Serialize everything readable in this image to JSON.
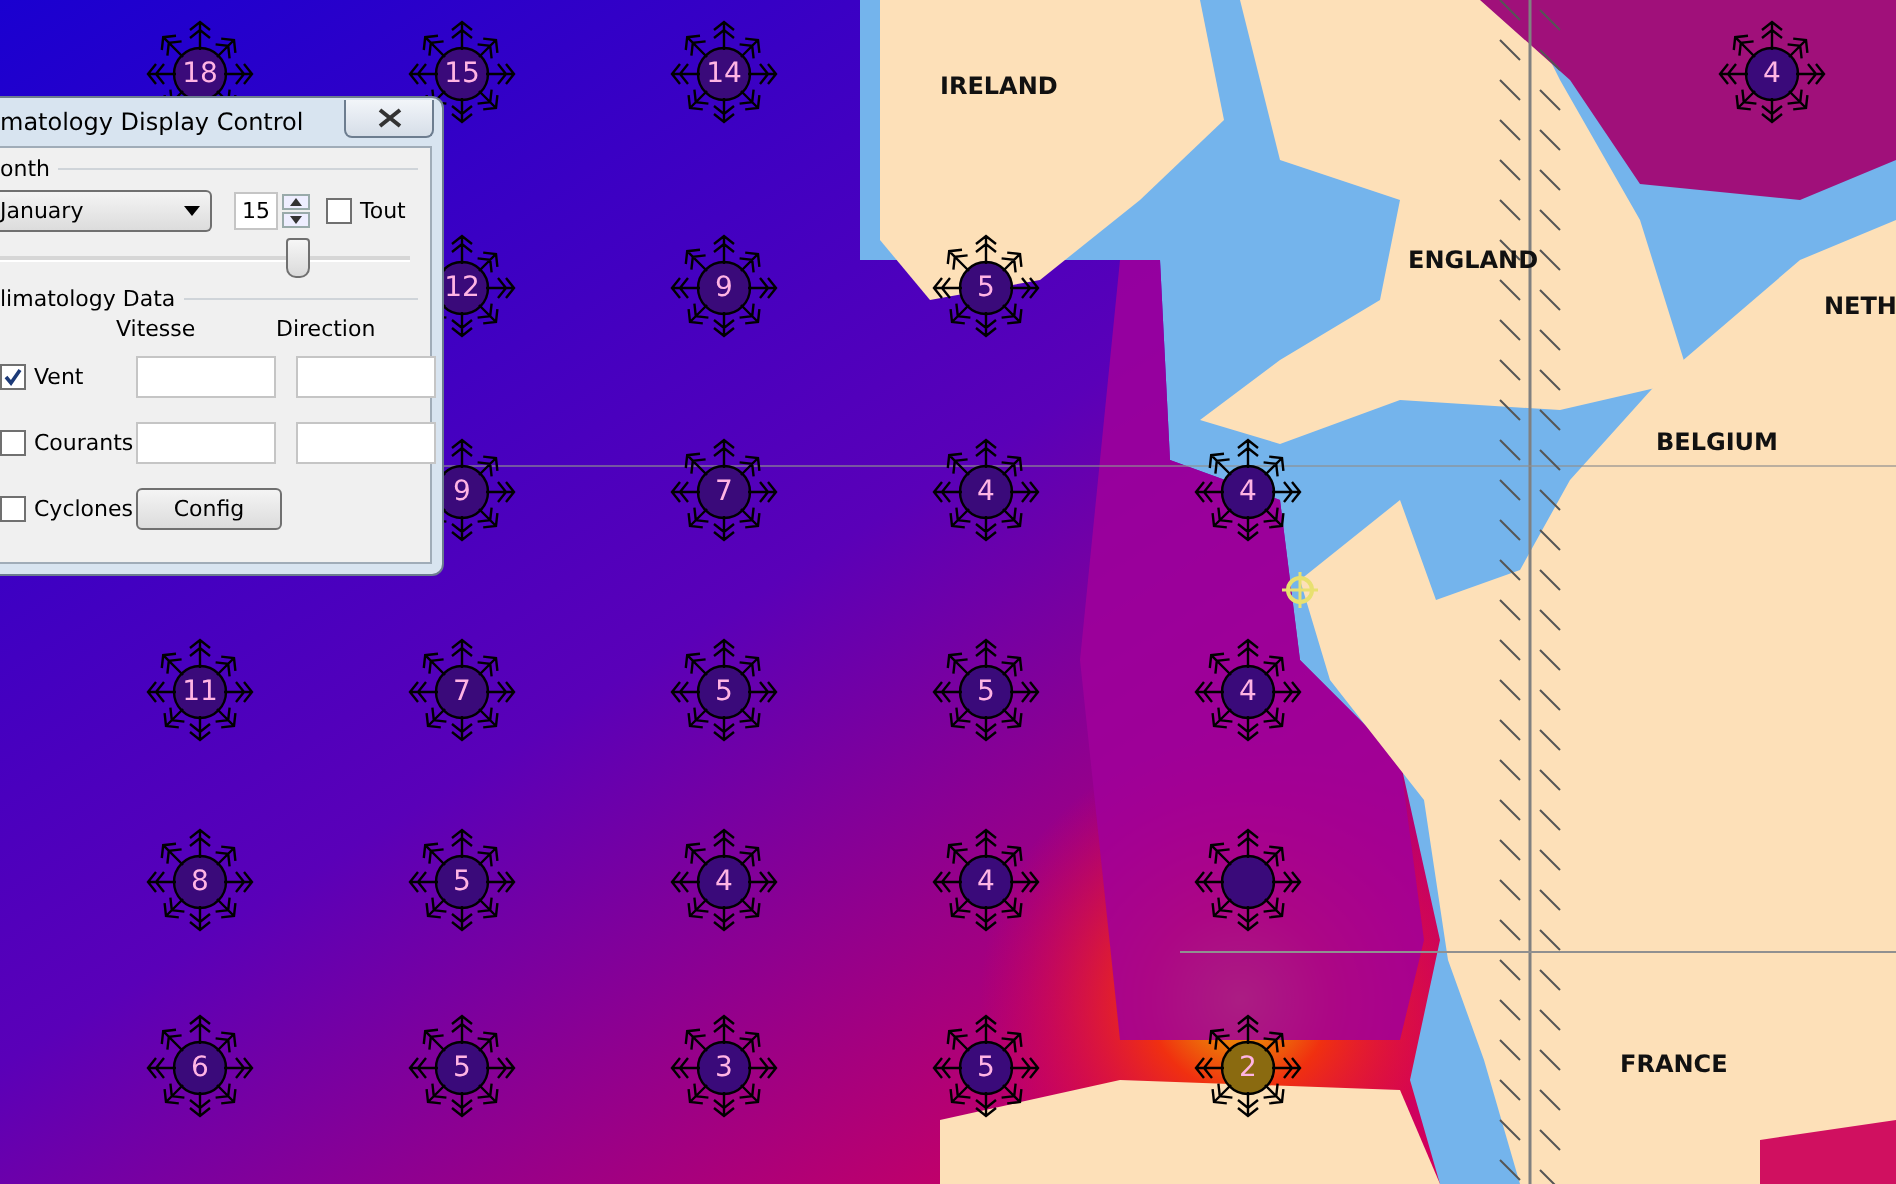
{
  "map": {
    "countries": [
      "IRELAND",
      "ENGLAND",
      "NETH",
      "BELGIUM",
      "FRANCE"
    ],
    "wind_roses": [
      {
        "kind": "labeled",
        "value": "18"
      },
      {
        "kind": "labeled",
        "value": "15"
      },
      {
        "kind": "labeled",
        "value": "14"
      },
      {
        "kind": "labeled",
        "value": "4"
      },
      {
        "kind": "labeled",
        "value": "12"
      },
      {
        "kind": "labeled",
        "value": "9"
      },
      {
        "kind": "labeled",
        "value": "5"
      },
      {
        "kind": "labeled",
        "value": "9"
      },
      {
        "kind": "labeled",
        "value": "7"
      },
      {
        "kind": "labeled",
        "value": "4"
      },
      {
        "kind": "labeled",
        "value": "4"
      },
      {
        "kind": "labeled",
        "value": "11"
      },
      {
        "kind": "labeled",
        "value": "7"
      },
      {
        "kind": "labeled",
        "value": "5"
      },
      {
        "kind": "labeled",
        "value": "5"
      },
      {
        "kind": "labeled",
        "value": "4"
      },
      {
        "kind": "labeled",
        "value": "8"
      },
      {
        "kind": "labeled",
        "value": "5"
      },
      {
        "kind": "labeled",
        "value": "4"
      },
      {
        "kind": "labeled",
        "value": "4"
      },
      {
        "kind": "blank"
      },
      {
        "kind": "labeled",
        "value": "6"
      },
      {
        "kind": "labeled",
        "value": "5"
      },
      {
        "kind": "labeled",
        "value": "3"
      },
      {
        "kind": "labeled",
        "value": "5"
      },
      {
        "kind": "labeled",
        "value": "2"
      }
    ]
  },
  "dialog": {
    "title": "matology Display Control",
    "month_group": {
      "label": "onth",
      "month": "January",
      "day": "15",
      "all": {
        "label": "Tout",
        "checked": false
      },
      "slider": {
        "level": 0.72
      }
    },
    "data_group": {
      "label": "limatology Data",
      "columns": [
        "Vitesse",
        "Direction"
      ],
      "rows": [
        {
          "kind": "fields",
          "label": "Vent",
          "checked": true
        },
        {
          "kind": "fields",
          "label": "Courants",
          "checked": false
        },
        {
          "kind": "button",
          "label": "Cyclones",
          "checked": false,
          "button": "Config"
        }
      ]
    }
  }
}
